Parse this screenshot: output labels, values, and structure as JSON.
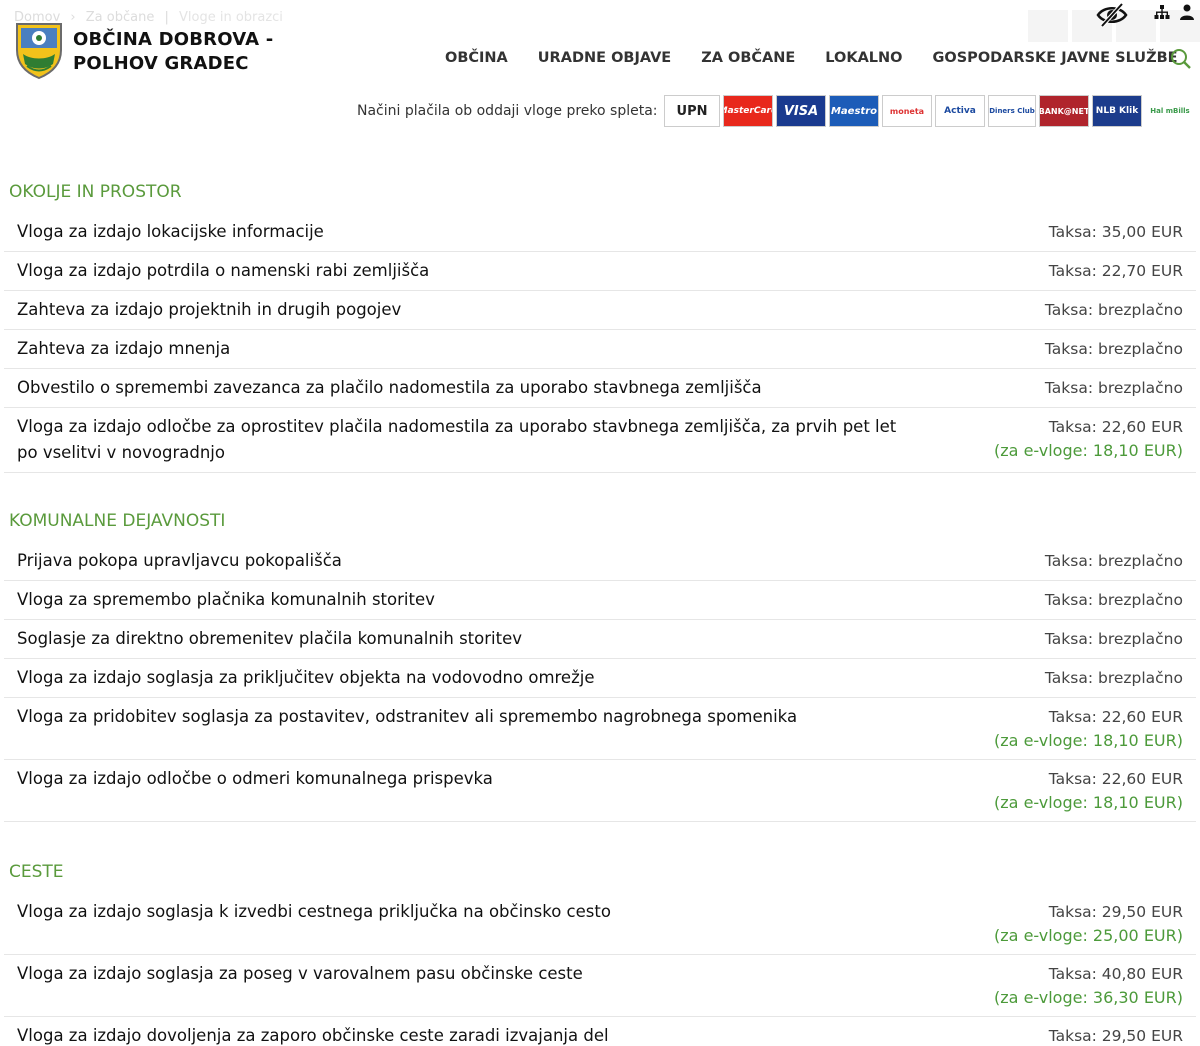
{
  "breadcrumb": {
    "home": "Domov",
    "sep1": "›",
    "parent": "Za občane",
    "sep2": "|",
    "current": "Vloge in obrazci"
  },
  "brand": {
    "line1": "OBČINA DOBROVA -",
    "line2": "POLHOV GRADEC"
  },
  "nav": {
    "items": [
      "OBČINA",
      "URADNE OBJAVE",
      "ZA OBČANE",
      "LOKALNO",
      "GOSPODARSKE JAVNE SLUŽBE"
    ]
  },
  "payments": {
    "label": "Načini plačila ob oddaji vloge preko spleta:",
    "methods": [
      "UPN",
      "MasterCard",
      "VISA",
      "Maestro",
      "moneta",
      "Activa",
      "Diners Club",
      "BANK@NET",
      "NLB Klik",
      "Hal mBills"
    ]
  },
  "colors": {
    "accent": "#5a9a3c",
    "text": "#111111"
  },
  "sections": [
    {
      "title": "OKOLJE IN PROSTOR",
      "rows": [
        {
          "name": "Vloga za izdajo lokacijske informacije",
          "fee": "Taksa: 35,00 EUR",
          "efee": ""
        },
        {
          "name": "Vloga za izdajo potrdila o namenski rabi zemljišča",
          "fee": "Taksa: 22,70 EUR",
          "efee": ""
        },
        {
          "name": "Zahteva za izdajo projektnih in drugih pogojev",
          "fee": "Taksa: brezplačno",
          "efee": ""
        },
        {
          "name": "Zahteva za izdajo mnenja",
          "fee": "Taksa: brezplačno",
          "efee": ""
        },
        {
          "name": "Obvestilo o spremembi zavezanca za plačilo nadomestila za uporabo stavbnega zemljišča",
          "fee": "Taksa: brezplačno",
          "efee": ""
        },
        {
          "name": "Vloga za izdajo odločbe za oprostitev plačila nadomestila za uporabo stavbnega zemljišča, za prvih pet let po vselitvi v novogradnjo",
          "fee": "Taksa: 22,60 EUR",
          "efee": "(za e-vloge: 18,10 EUR)"
        }
      ]
    },
    {
      "title": "KOMUNALNE DEJAVNOSTI",
      "rows": [
        {
          "name": "Prijava pokopa upravljavcu pokopališča",
          "fee": "Taksa: brezplačno",
          "efee": ""
        },
        {
          "name": "Vloga za spremembo plačnika komunalnih storitev",
          "fee": "Taksa: brezplačno",
          "efee": ""
        },
        {
          "name": "Soglasje za direktno obremenitev plačila komunalnih storitev",
          "fee": "Taksa: brezplačno",
          "efee": ""
        },
        {
          "name": "Vloga za izdajo soglasja za priključitev objekta na vodovodno omrežje",
          "fee": "Taksa: brezplačno",
          "efee": ""
        },
        {
          "name": "Vloga za pridobitev soglasja za postavitev, odstranitev ali spremembo nagrobnega spomenika",
          "fee": "Taksa: 22,60 EUR",
          "efee": "(za e-vloge: 18,10 EUR)"
        },
        {
          "name": "Vloga za izdajo odločbe o odmeri komunalnega prispevka",
          "fee": "Taksa: 22,60 EUR",
          "efee": "(za e-vloge: 18,10 EUR)"
        }
      ]
    },
    {
      "title": "CESTE",
      "rows": [
        {
          "name": "Vloga za izdajo soglasja k izvedbi cestnega priključka na občinsko cesto",
          "fee": "Taksa: 29,50 EUR",
          "efee": "(za e-vloge: 25,00 EUR)"
        },
        {
          "name": "Vloga za izdajo soglasja za poseg v varovalnem pasu občinske ceste",
          "fee": "Taksa: 40,80 EUR",
          "efee": "(za e-vloge: 36,30 EUR)"
        },
        {
          "name": "Vloga za izdajo dovoljenja za zaporo občinske ceste zaradi izvajanja del",
          "fee": "Taksa: 29,50 EUR",
          "efee": ""
        }
      ]
    }
  ]
}
